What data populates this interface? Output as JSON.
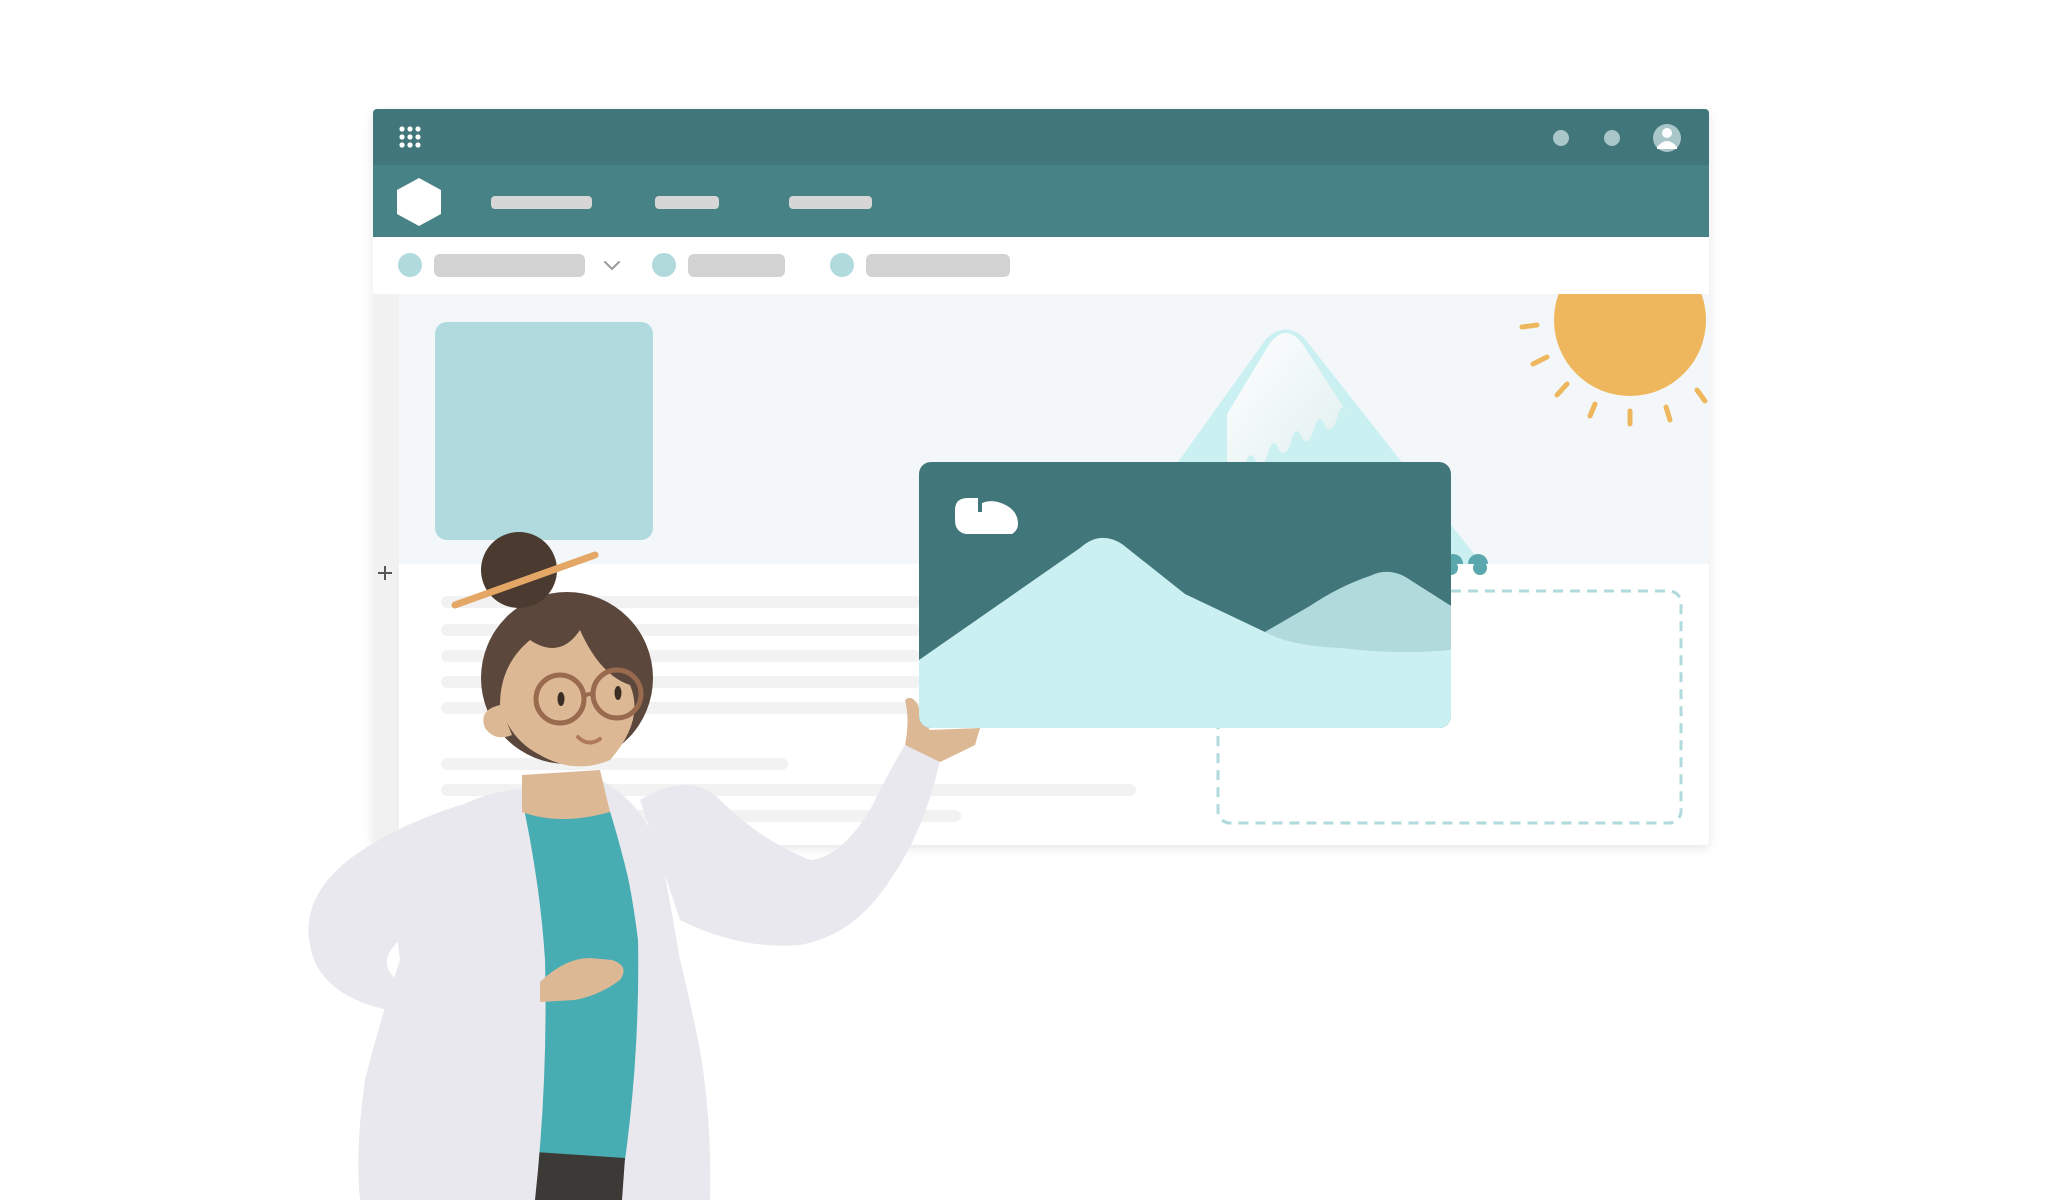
{
  "colors": {
    "topbar": "#41767a",
    "navbar": "#478286",
    "canvas": "#f3f7f9",
    "skeleton": "#d2d2d2",
    "dot": "#b1dadd",
    "teal_light": "#cbf0f1",
    "sun": "#eeb75e",
    "coat": "#e8e8ee",
    "shirt": "#47adb2",
    "hair": "#5b473b",
    "skin": "#ddb895"
  },
  "icons": {
    "app_launcher": "grid-icon",
    "brand": "hexagon-icon",
    "header_dot_1": "circle-icon",
    "header_dot_2": "circle-icon",
    "profile": "user-icon",
    "dropdown": "chevron-down-icon",
    "add": "plus-icon",
    "image": "image-icon"
  }
}
